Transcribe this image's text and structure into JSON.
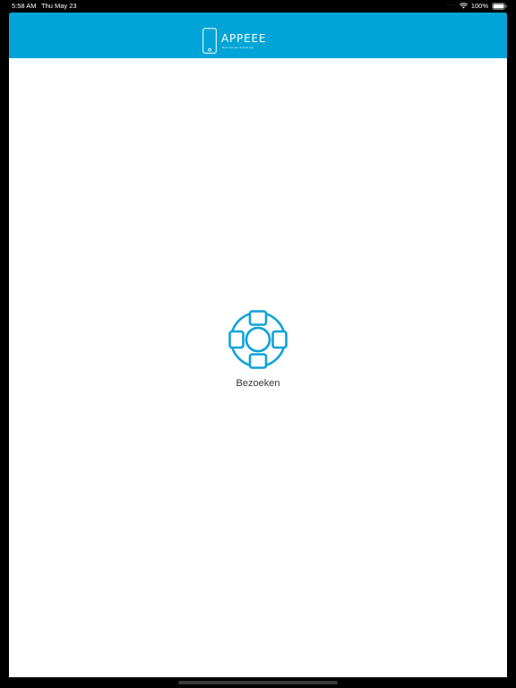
{
  "status_bar": {
    "time": "5:58 AM",
    "date": "Thu May 23",
    "battery": "100%",
    "signal_indicator": "····",
    "icons": [
      "wifi-icon",
      "battery-icon"
    ]
  },
  "header": {
    "background_color": "#00a4d7",
    "logo": {
      "title": "APPEEE",
      "tagline": "Meer dan een Sociale App",
      "icon": "phone-outline-icon"
    }
  },
  "main": {
    "tiles": [
      {
        "label": "Bezoeken",
        "icon": "lifebuoy-icon",
        "color": "#0fa3d6"
      }
    ]
  }
}
